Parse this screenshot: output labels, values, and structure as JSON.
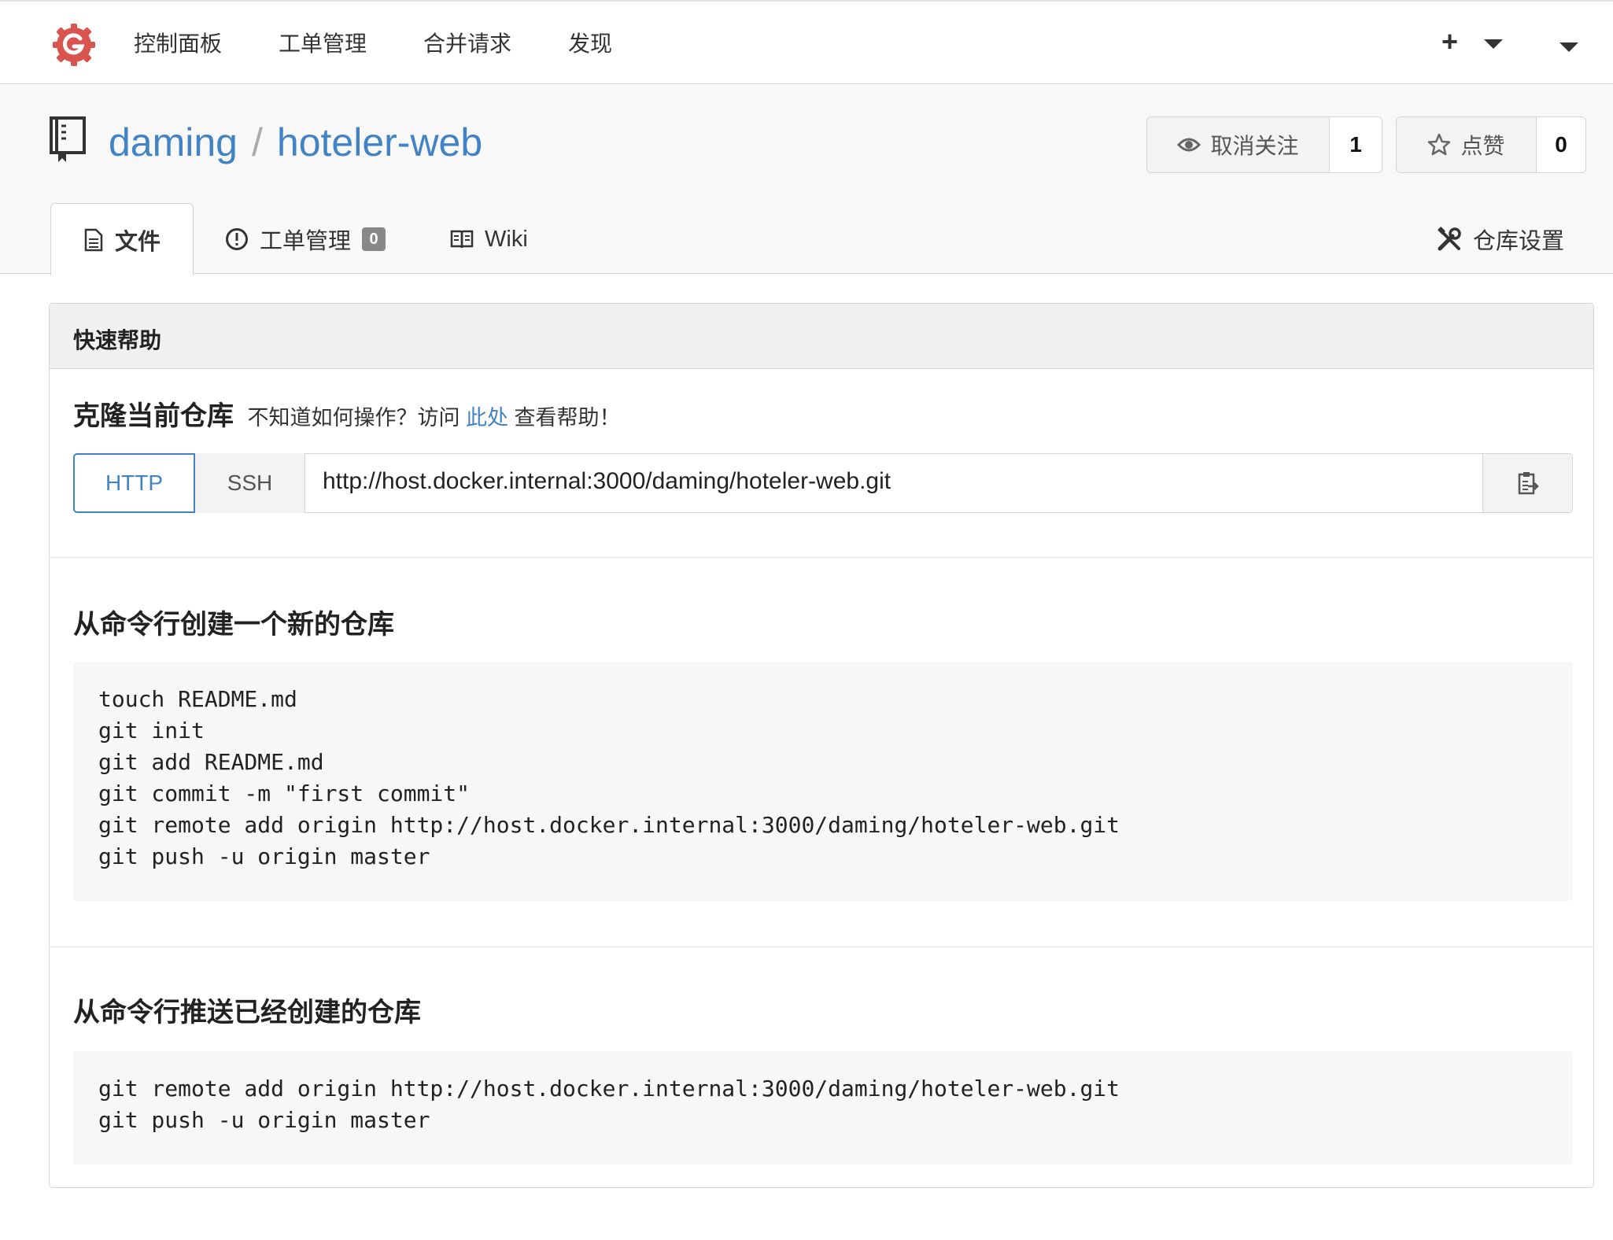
{
  "nav": {
    "items": [
      "控制面板",
      "工单管理",
      "合并请求",
      "发现"
    ],
    "plus": "+"
  },
  "repo": {
    "owner": "daming",
    "separator": "/",
    "name": "hoteler-web",
    "watch_label": "取消关注",
    "watch_count": "1",
    "star_label": "点赞",
    "star_count": "0"
  },
  "tabs": {
    "files": "文件",
    "issues": "工单管理",
    "issues_count": "0",
    "wiki": "Wiki",
    "settings": "仓库设置"
  },
  "quick_help": {
    "header": "快速帮助",
    "clone_title": "克隆当前仓库",
    "hint_prefix": "不知道如何操作？访问",
    "hint_link": "此处",
    "hint_suffix": "查看帮助！",
    "http_label": "HTTP",
    "ssh_label": "SSH",
    "clone_url": "http://host.docker.internal:3000/daming/hoteler-web.git",
    "new_repo_title": "从命令行创建一个新的仓库",
    "new_repo_lines": [
      "touch README.md",
      "git init",
      "git add README.md",
      "git commit -m \"first commit\"",
      "git remote add origin http://host.docker.internal:3000/daming/hoteler-web.git",
      "git push -u origin master"
    ],
    "push_existing_title": "从命令行推送已经创建的仓库",
    "push_existing_lines": [
      "git remote add origin http://host.docker.internal:3000/daming/hoteler-web.git",
      "git push -u origin master"
    ]
  },
  "colors": {
    "link": "#4183c4",
    "logo": "#d9534f"
  },
  "icons": {
    "logo": "gitea-logo-icon",
    "repo": "repo-book-icon",
    "watch": "eye-icon",
    "star": "star-icon",
    "files": "file-text-icon",
    "issues": "issue-opened-icon",
    "wiki": "book-icon",
    "settings": "tools-icon",
    "copy": "clippy-icon"
  }
}
